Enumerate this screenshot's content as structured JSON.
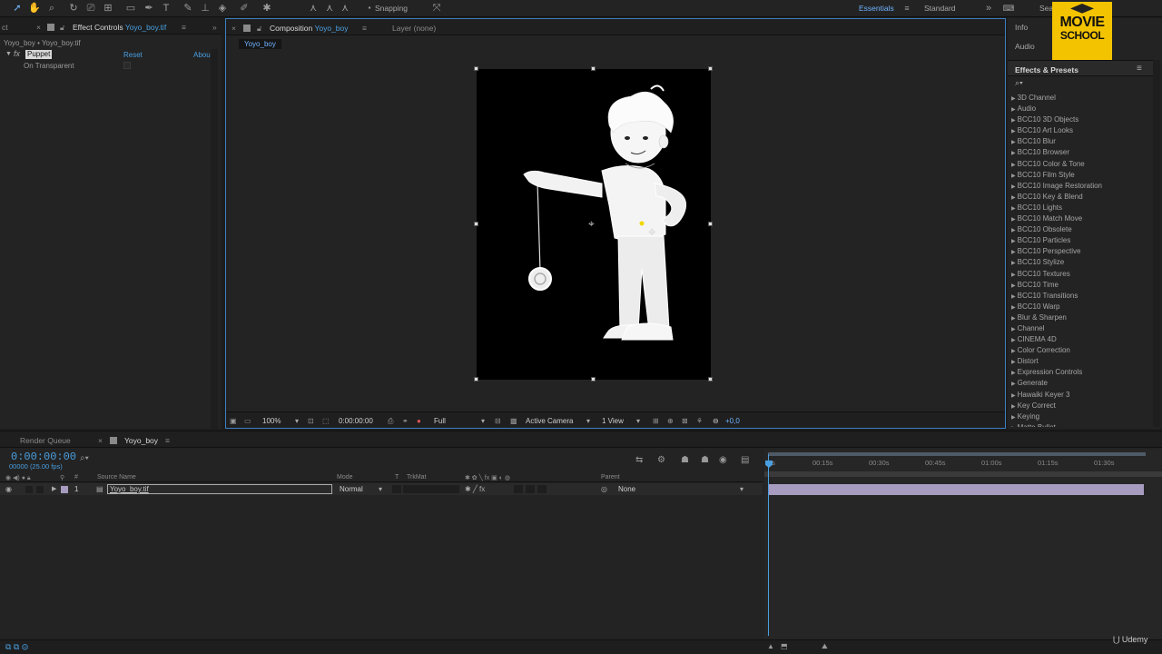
{
  "toolbar": {
    "snapping_label": "Snapping",
    "workspaces": [
      "Essentials",
      "Standard"
    ],
    "search_label": "Sea",
    "tools": [
      "selection-tool-icon",
      "hand-tool-icon",
      "zoom-tool-icon",
      "rotate-tool-icon",
      "camera-tool-icon",
      "pan-behind-tool-icon",
      "rectangle-tool-icon",
      "pen-tool-icon",
      "type-tool-icon",
      "brush-tool-icon",
      "clone-stamp-tool-icon",
      "eraser-tool-icon",
      "roto-brush-tool-icon",
      "puppet-tool-icon"
    ]
  },
  "logo": {
    "line1": "MOVIE",
    "line2": "SCHOOL"
  },
  "left_panel": {
    "prev_tab": "ct",
    "tab_label": "Effect Controls",
    "tab_file": "Yoyo_boy.tif",
    "subtitle": "Yoyo_boy • Yoyo_boy.tif",
    "effect_name": "Puppet",
    "reset_label": "Reset",
    "about_label": "Abou",
    "property_label": "On Transparent"
  },
  "comp_panel": {
    "tab_prefix": "Composition",
    "tab_name": "Yoyo_boy",
    "layer_tab": "Layer (none)",
    "comp_chip": "Yoyo_boy",
    "footer": {
      "zoom": "100%",
      "timecode": "0:00:00:00",
      "resolution": "Full",
      "camera": "Active Camera",
      "views": "1 View",
      "exposure": "+0,0"
    }
  },
  "right_panel": {
    "info_label": "Info",
    "audio_label": "Audio",
    "effects_title": "Effects & Presets",
    "effects_list": [
      "3D Channel",
      "Audio",
      "BCC10 3D Objects",
      "BCC10 Art Looks",
      "BCC10 Blur",
      "BCC10 Browser",
      "BCC10 Color & Tone",
      "BCC10 Film Style",
      "BCC10 Image Restoration",
      "BCC10 Key & Blend",
      "BCC10 Lights",
      "BCC10 Match Move",
      "BCC10 Obsolete",
      "BCC10 Particles",
      "BCC10 Perspective",
      "BCC10 Stylize",
      "BCC10 Textures",
      "BCC10 Time",
      "BCC10 Transitions",
      "BCC10 Warp",
      "Blur & Sharpen",
      "Channel",
      "CINEMA 4D",
      "Color Correction",
      "Distort",
      "Expression Controls",
      "Generate",
      "Hawaiki Keyer 3",
      "Key Correct",
      "Keying",
      "Matte Bullet"
    ]
  },
  "timeline": {
    "render_queue_tab": "Render Queue",
    "comp_tab": "Yoyo_boy",
    "current_time": "0:00:00:00",
    "frames": "00000 (25.00 fps)",
    "columns": {
      "number": "#",
      "source": "Source Name",
      "mode": "Mode",
      "t": "T",
      "trkmat": "TrkMat",
      "parent": "Parent"
    },
    "layer": {
      "index": "1",
      "name": "Yoyo_boy.tif",
      "mode": "Normal",
      "parent": "None"
    },
    "ruler": [
      "0s",
      "00:15s",
      "00:30s",
      "00:45s",
      "01:00s",
      "01:15s",
      "01:30s"
    ]
  },
  "watermark": "Udemy",
  "colors": {
    "accent": "#4a9fe0",
    "logo_bg": "#f4c300",
    "layer_bar": "#a79cbf"
  }
}
